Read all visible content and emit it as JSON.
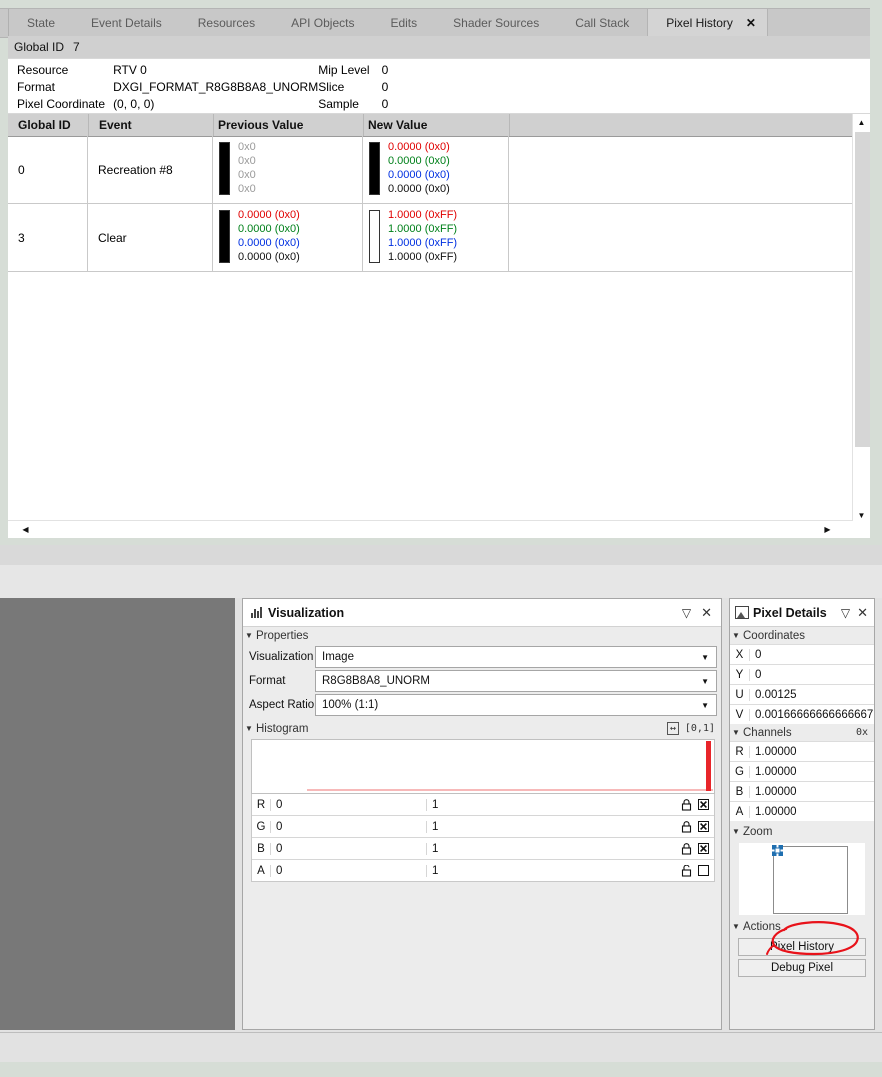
{
  "tabs": [
    {
      "label": "State",
      "active": false
    },
    {
      "label": "Event Details",
      "active": false
    },
    {
      "label": "Resources",
      "active": false
    },
    {
      "label": "API Objects",
      "active": false
    },
    {
      "label": "Edits",
      "active": false
    },
    {
      "label": "Shader Sources",
      "active": false
    },
    {
      "label": "Call Stack",
      "active": false
    },
    {
      "label": "Pixel History",
      "active": true
    }
  ],
  "tab_close_glyph": "✕",
  "global_id_bar": {
    "label": "Global ID",
    "value": "7"
  },
  "info": {
    "resource_label": "Resource",
    "resource_value": "RTV 0",
    "format_label": "Format",
    "format_value": "DXGI_FORMAT_R8G8B8A8_UNORM",
    "pixel_coord_label": "Pixel Coordinate",
    "pixel_coord_value": "(0, 0, 0)",
    "mip_label": "Mip Level",
    "mip_value": "0",
    "slice_label": "Slice",
    "slice_value": "0",
    "sample_label": "Sample",
    "sample_value": "0"
  },
  "grid": {
    "columns": [
      "Global ID",
      "Event",
      "Previous Value",
      "New Value"
    ],
    "rows": [
      {
        "id": "0",
        "event": "Recreation #8",
        "prev": {
          "swatch": "black",
          "dim": true,
          "lines": [
            "0x0",
            "0x0",
            "0x0",
            "0x0"
          ]
        },
        "next": {
          "swatch": "black",
          "dim": false,
          "lines": [
            "0.0000 (0x0)",
            "0.0000 (0x0)",
            "0.0000 (0x0)",
            "0.0000 (0x0)"
          ]
        }
      },
      {
        "id": "3",
        "event": "Clear",
        "prev": {
          "swatch": "black",
          "dim": false,
          "lines": [
            "0.0000 (0x0)",
            "0.0000 (0x0)",
            "0.0000 (0x0)",
            "0.0000 (0x0)"
          ]
        },
        "next": {
          "swatch": "white",
          "dim": false,
          "lines": [
            "1.0000 (0xFF)",
            "1.0000 (0xFF)",
            "1.0000 (0xFF)",
            "1.0000 (0xFF)"
          ]
        }
      }
    ]
  },
  "visualization": {
    "title": "Visualization",
    "icon": "histogram-icon",
    "collapse_glyph": "▽",
    "close_glyph": "✕",
    "properties_section": "Properties",
    "properties": [
      {
        "label": "Visualization",
        "value": "Image"
      },
      {
        "label": "Format",
        "value": "R8G8B8A8_UNORM"
      },
      {
        "label": "Aspect Ratio",
        "value": "100% (1:1)"
      }
    ],
    "histogram_section": "Histogram",
    "histogram_range": "[0,1]",
    "channels": [
      {
        "name": "R",
        "min": "0",
        "max": "1",
        "locked": true,
        "enabled": true
      },
      {
        "name": "G",
        "min": "0",
        "max": "1",
        "locked": true,
        "enabled": true
      },
      {
        "name": "B",
        "min": "0",
        "max": "1",
        "locked": true,
        "enabled": true
      },
      {
        "name": "A",
        "min": "0",
        "max": "1",
        "locked": false,
        "enabled": false
      }
    ]
  },
  "pixel_details": {
    "title": "Pixel Details",
    "icon": "image-pixel-icon",
    "collapse_glyph": "▽",
    "close_glyph": "✕",
    "coordinates_section": "Coordinates",
    "coordinates": [
      {
        "key": "X",
        "value": "0"
      },
      {
        "key": "Y",
        "value": "0"
      },
      {
        "key": "U",
        "value": "0.00125"
      },
      {
        "key": "V",
        "value": "0.00166666666666667"
      }
    ],
    "channels_section": "Channels",
    "channels_mode": "0x",
    "channels": [
      {
        "key": "R",
        "value": "1.00000"
      },
      {
        "key": "G",
        "value": "1.00000"
      },
      {
        "key": "B",
        "value": "1.00000"
      },
      {
        "key": "A",
        "value": "1.00000"
      }
    ],
    "zoom_section": "Zoom",
    "actions_section": "Actions",
    "actions": [
      {
        "label": "Pixel History",
        "highlighted": true
      },
      {
        "label": "Debug Pixel",
        "highlighted": false
      }
    ]
  },
  "colors": {
    "accent_red": "#e8252a",
    "channel_r": "#e00000",
    "channel_g": "#00801a",
    "channel_b": "#0030e0",
    "annotation": "#e8121a",
    "panel_bg": "#ececec",
    "texture_view_bg": "#787878"
  }
}
